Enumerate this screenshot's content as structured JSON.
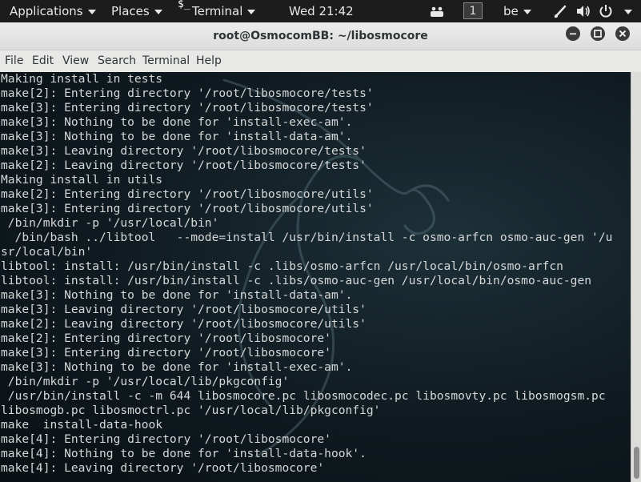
{
  "top_panel": {
    "applications": "Applications",
    "places": "Places",
    "terminal_menu": "Terminal",
    "clock": "Wed 21:42",
    "workspace": "1",
    "keyboard_layout": "be"
  },
  "window": {
    "title": "root@OsmocomBB: ~/libosmocore",
    "menu": [
      "File",
      "Edit",
      "View",
      "Search",
      "Terminal",
      "Help"
    ]
  },
  "terminal": {
    "lines": [
      "Making install in tests",
      "make[2]: Entering directory '/root/libosmocore/tests'",
      "make[3]: Entering directory '/root/libosmocore/tests'",
      "make[3]: Nothing to be done for 'install-exec-am'.",
      "make[3]: Nothing to be done for 'install-data-am'.",
      "make[3]: Leaving directory '/root/libosmocore/tests'",
      "make[2]: Leaving directory '/root/libosmocore/tests'",
      "Making install in utils",
      "make[2]: Entering directory '/root/libosmocore/utils'",
      "make[3]: Entering directory '/root/libosmocore/utils'",
      " /bin/mkdir -p '/usr/local/bin'",
      "  /bin/bash ../libtool   --mode=install /usr/bin/install -c osmo-arfcn osmo-auc-gen '/u",
      "sr/local/bin'",
      "libtool: install: /usr/bin/install -c .libs/osmo-arfcn /usr/local/bin/osmo-arfcn",
      "libtool: install: /usr/bin/install -c .libs/osmo-auc-gen /usr/local/bin/osmo-auc-gen",
      "make[3]: Nothing to be done for 'install-data-am'.",
      "make[3]: Leaving directory '/root/libosmocore/utils'",
      "make[2]: Leaving directory '/root/libosmocore/utils'",
      "make[2]: Entering directory '/root/libosmocore'",
      "make[3]: Entering directory '/root/libosmocore'",
      "make[3]: Nothing to be done for 'install-exec-am'.",
      " /bin/mkdir -p '/usr/local/lib/pkgconfig'",
      " /usr/bin/install -c -m 644 libosmocore.pc libosmocodec.pc libosmovty.pc libosmogsm.pc",
      "libosmogb.pc libosmoctrl.pc '/usr/local/lib/pkgconfig'",
      "make  install-data-hook",
      "make[4]: Entering directory '/root/libosmocore'",
      "make[4]: Nothing to be done for 'install-data-hook'.",
      "make[4]: Leaving directory '/root/libosmocore'"
    ]
  }
}
